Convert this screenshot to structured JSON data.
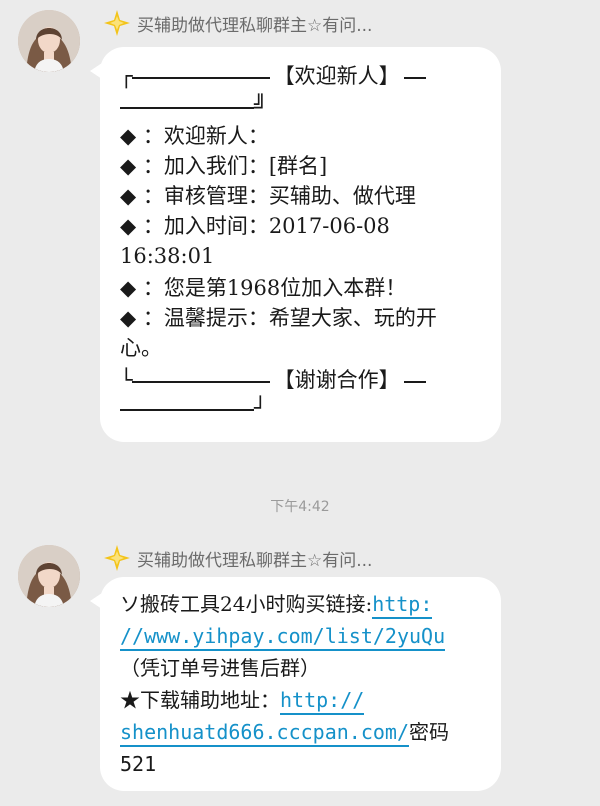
{
  "messages": [
    {
      "sender": {
        "name": "买辅助做代理私聊群主☆有问...",
        "badge_icon": "diamond-badge-icon"
      },
      "card": {
        "header_title": "【欢迎新人】",
        "footer_title": "【谢谢合作】",
        "lines": [
          "◆ ：欢迎新人：",
          "◆ ：加入我们：[群名]",
          "◆ ：审核管理：买辅助、做代理",
          "◆ ：加入时间：2017-06-08",
          "16:38:01",
          "◆ ：您是第1968位加入本群！",
          "◆ ：温馨提示：希望大家、玩的开",
          "心。"
        ]
      }
    },
    {
      "sender": {
        "name": "买辅助做代理私聊群主☆有问...",
        "badge_icon": "diamond-badge-icon"
      },
      "content": {
        "line1_prefix": "ソ搬砖工具24小时购买链接:",
        "link1_part1": "http:",
        "link1_part2": "//www.yihpay.com/list/2yuQu",
        "line3": "（凭订单号进售后群）",
        "line4_prefix": "★下载辅助地址：",
        "link2_part1": "http://",
        "link2_part2": "shenhuatd666.cccpan.com/",
        "line5_suffix": "密码",
        "line6": "521"
      }
    }
  ],
  "timestamp": "下午4:42",
  "colors": {
    "background": "#ebebeb",
    "bubble": "#ffffff",
    "link": "#1591c9",
    "badge": "#f3c41a"
  }
}
